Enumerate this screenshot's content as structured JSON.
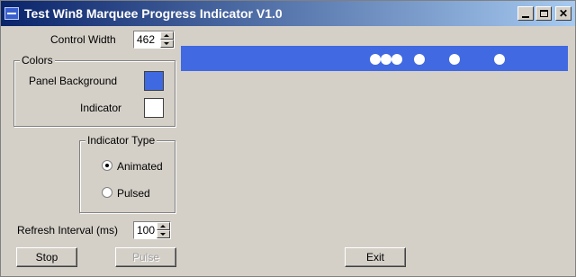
{
  "window": {
    "title": "Test Win8 Marquee Progress Indicator V1.0",
    "controls": {
      "minimize": "minimize",
      "maximize": "maximize",
      "close": "✕"
    }
  },
  "settings": {
    "control_width_label": "Control Width",
    "control_width_value": "462",
    "refresh_interval_label": "Refresh Interval (ms)",
    "refresh_interval_value": "100"
  },
  "colors_group": {
    "caption": "Colors",
    "panel_background_label": "Panel Background",
    "panel_background_color": "#3f69e0",
    "indicator_label": "Indicator",
    "indicator_color": "#ffffff"
  },
  "indicator_type_group": {
    "caption": "Indicator Type",
    "options": [
      {
        "label": "Animated",
        "checked": true
      },
      {
        "label": "Pulsed",
        "checked": false
      }
    ]
  },
  "buttons": {
    "stop": "Stop",
    "pulse": "Pulse",
    "exit": "Exit"
  },
  "colors": {
    "titlebar_start": "#0a246a",
    "titlebar_end": "#a6caf0",
    "marquee_background": "#4169e1",
    "marquee_dot": "#ffffff"
  }
}
